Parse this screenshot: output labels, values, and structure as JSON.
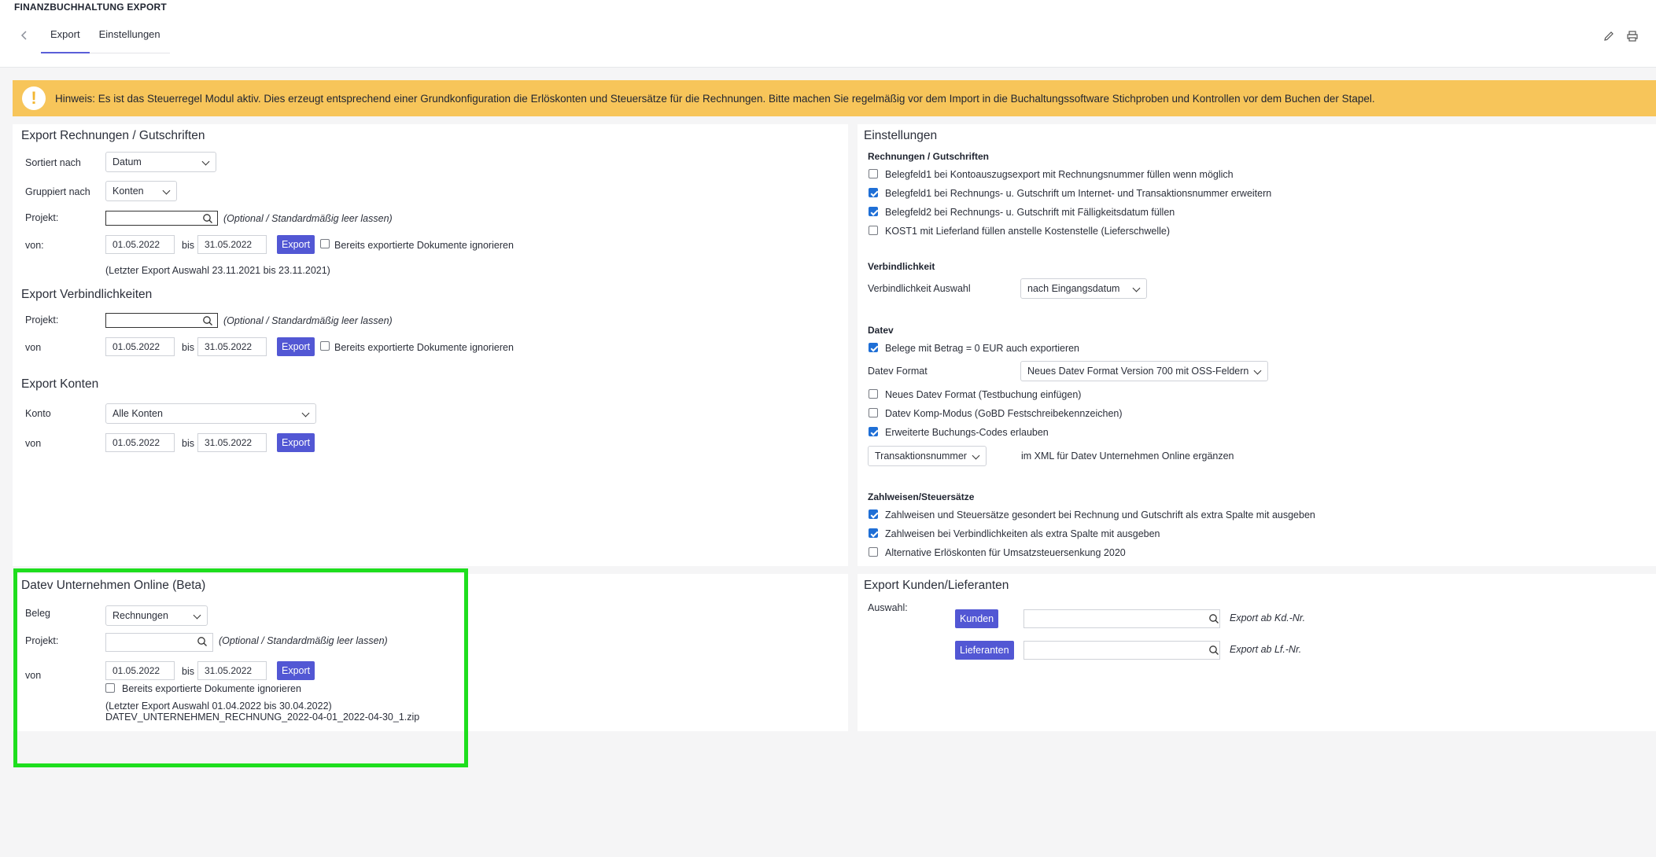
{
  "header": {
    "app_title": "FINANZBUCHHALTUNG EXPORT",
    "tabs": [
      "Export",
      "Einstellungen"
    ]
  },
  "notice": {
    "text": "Hinweis: Es ist das Steuerregel Modul aktiv. Dies erzeugt entsprechend einer Grundkonfiguration die Erlöskonten und Steuersätze für die Rechnungen. Bitte machen Sie regelmäßig vor dem Import in die Buchaltungssoftware Stichproben und Kontrollen vor dem Buchen der Stapel."
  },
  "export_rechnungen": {
    "title": "Export Rechnungen / Gutschriften",
    "sort_label": "Sortiert nach",
    "sort_value": "Datum",
    "group_label": "Gruppiert nach",
    "group_value": "Konten",
    "project_label": "Projekt:",
    "project_hint": "(Optional / Standardmäßig leer lassen)",
    "from_label": "von:",
    "from_date": "01.05.2022",
    "to_label": "bis",
    "to_date": "31.05.2022",
    "export_button": "Export",
    "ignore_label": "Bereits exportierte Dokumente ignorieren",
    "last_export": "(Letzter Export Auswahl 23.11.2021 bis 23.11.2021)"
  },
  "export_verbindlichkeiten": {
    "title": "Export Verbindlichkeiten",
    "project_label": "Projekt:",
    "project_hint": "(Optional / Standardmäßig leer lassen)",
    "from_label": "von",
    "from_date": "01.05.2022",
    "to_label": "bis",
    "to_date": "31.05.2022",
    "export_button": "Export",
    "ignore_label": "Bereits exportierte Dokumente ignorieren"
  },
  "export_konten": {
    "title": "Export Konten",
    "konto_label": "Konto",
    "konto_value": "Alle Konten",
    "from_label": "von",
    "from_date": "01.05.2022",
    "to_label": "bis",
    "to_date": "31.05.2022",
    "export_button": "Export"
  },
  "datev_online": {
    "title": "Datev Unternehmen Online (Beta)",
    "beleg_label": "Beleg",
    "beleg_value": "Rechnungen",
    "project_label": "Projekt:",
    "project_hint": "(Optional / Standardmäßig leer lassen)",
    "from_label": "von",
    "from_date": "01.05.2022",
    "to_label": "bis",
    "to_date": "31.05.2022",
    "export_button": "Export",
    "ignore_label": "Bereits exportierte Dokumente ignorieren",
    "last_export": "(Letzter Export Auswahl 01.04.2022 bis 30.04.2022)",
    "last_file": "DATEV_UNTERNEHMEN_RECHNUNG_2022-04-01_2022-04-30_1.zip"
  },
  "einstellungen": {
    "title": "Einstellungen",
    "rechnungen_heading": "Rechnungen / Gutschriften",
    "rechnungen_options": [
      {
        "label": "Belegfeld1 bei Kontoauszugsexport mit Rechnungsnummer füllen wenn möglich",
        "checked": false
      },
      {
        "label": "Belegfeld1 bei Rechnungs- u. Gutschrift um Internet- und Transaktionsnummer erweitern",
        "checked": true
      },
      {
        "label": "Belegfeld2 bei Rechnungs- u. Gutschrift mit Fälligkeitsdatum füllen",
        "checked": true
      },
      {
        "label": "KOST1 mit Lieferland füllen anstelle Kostenstelle (Lieferschwelle)",
        "checked": false
      }
    ],
    "verbindlichkeit_heading": "Verbindlichkeit",
    "verbindlichkeit_label": "Verbindlichkeit Auswahl",
    "verbindlichkeit_value": "nach Eingangsdatum",
    "datev_heading": "Datev",
    "datev_option_betrag": {
      "label": "Belege mit Betrag = 0 EUR auch exportieren",
      "checked": true
    },
    "datev_format_label": "Datev Format",
    "datev_format_value": "Neues Datev Format Version 700 mit OSS-Feldern",
    "datev_options": [
      {
        "label": "Neues Datev Format (Testbuchung einfügen)",
        "checked": false
      },
      {
        "label": "Datev Komp-Modus (GoBD Festschreibekennzeichen)",
        "checked": false
      },
      {
        "label": "Erweiterte Buchungs-Codes erlauben",
        "checked": true
      }
    ],
    "xml_select_value": "Transaktionsnummer",
    "xml_text": "im XML für Datev Unternehmen Online ergänzen",
    "zahlweisen_heading": "Zahlweisen/Steuersätze",
    "zahlweisen_options": [
      {
        "label": "Zahlweisen und Steuersätze gesondert bei Rechnung und Gutschrift als extra Spalte mit ausgeben",
        "checked": true
      },
      {
        "label": "Zahlweisen bei Verbindlichkeiten als extra Spalte mit ausgeben",
        "checked": true
      },
      {
        "label": "Alternative Erlöskonten für Umsatzsteuersenkung 2020",
        "checked": false
      }
    ]
  },
  "export_kunden": {
    "title": "Export Kunden/Lieferanten",
    "auswahl_label": "Auswahl:",
    "kunden_button": "Kunden",
    "kunden_hint": "Export ab Kd.-Nr.",
    "lieferanten_button": "Lieferanten",
    "lieferanten_hint": "Export ab Lf.-Nr."
  },
  "colors": {
    "accent": "#5257d4",
    "notice": "#f7c55a",
    "highlight": "#1ede1e"
  }
}
